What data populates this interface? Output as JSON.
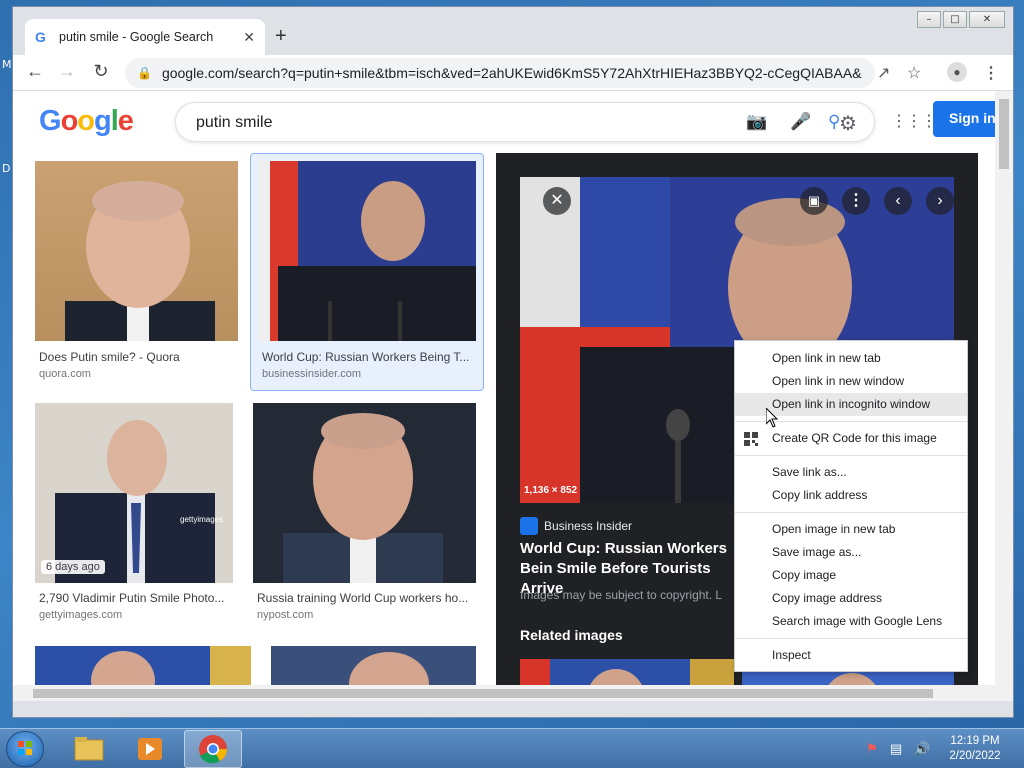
{
  "desktop": {
    "left_letters": [
      "M",
      "D"
    ]
  },
  "window": {
    "controls": {
      "minimize": "–",
      "maximize": "□",
      "close": "✕"
    }
  },
  "tab": {
    "title": "putin smile - Google Search",
    "favicon": "G",
    "close": "✕",
    "new_tab": "+"
  },
  "toolbar": {
    "url": "google.com/search?q=putin+smile&tbm=isch&ved=2ahUKEwid6KmS5Y72AhXtrHIEHaz3BBYQ2-cCegQIABAA&o..."
  },
  "google": {
    "logo_letters": [
      "G",
      "o",
      "o",
      "g",
      "l",
      "e"
    ],
    "query": "putin smile",
    "sign_in": "Sign in"
  },
  "results": [
    {
      "caption": "Does Putin smile? - Quora",
      "source": "quora.com"
    },
    {
      "caption": "World Cup: Russian Workers Being T...",
      "source": "businessinsider.com"
    },
    {
      "caption": "2,790 Vladimir Putin Smile Photo...",
      "source": "gettyimages.com",
      "badge": "6 days ago",
      "watermark": "gettyimages"
    },
    {
      "caption": "Russia training World Cup workers ho...",
      "source": "nypost.com"
    }
  ],
  "preview": {
    "dimensions": "1,136 × 852",
    "source": "Business Insider",
    "title": "World Cup: Russian Workers Bein Smile Before Tourists Arrive",
    "copyright": "Images may be subject to copyright. L",
    "related": "Related images"
  },
  "context_menu": {
    "group1": [
      "Open link in new tab",
      "Open link in new window",
      "Open link in incognito window"
    ],
    "group2": [
      "Create QR Code for this image"
    ],
    "group3": [
      "Save link as...",
      "Copy link address"
    ],
    "group4": [
      "Open image in new tab",
      "Save image as...",
      "Copy image",
      "Copy image address",
      "Search image with Google Lens"
    ],
    "group5": [
      "Inspect"
    ]
  },
  "taskbar": {
    "time": "12:19 PM",
    "date": "2/20/2022"
  },
  "colors": {
    "accent": "#1a73e8",
    "panel_bg": "#202124",
    "taskbar": "#4a7db5"
  }
}
